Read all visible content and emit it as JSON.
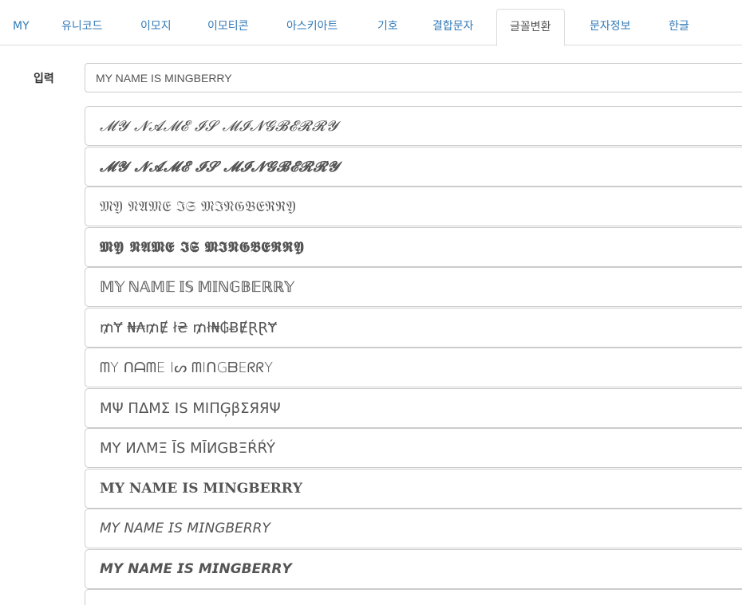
{
  "tabs": [
    {
      "label": "MY"
    },
    {
      "label": "유니코드"
    },
    {
      "label": "이모지"
    },
    {
      "label": "이모티콘"
    },
    {
      "label": "아스키아트"
    },
    {
      "label": "기호"
    },
    {
      "label": "결합문자"
    },
    {
      "label": "글꼴변환"
    },
    {
      "label": "문자정보"
    },
    {
      "label": "한글"
    }
  ],
  "active_tab": "글꼴변환",
  "input": {
    "label": "입력",
    "value": "MY NAME IS MINGBERRY"
  },
  "results": [
    {
      "text": "𝓜𝓨 𝓝𝓐𝓜𝓔 𝓘𝓢 𝓜𝓘𝓝𝓖𝓑𝓔𝓡𝓡𝓨"
    },
    {
      "text": "𝓜𝓨 𝓝𝓐𝓜𝓔 𝓘𝓢 𝓜𝓘𝓝𝓖𝓑𝓔𝓡𝓡𝓨"
    },
    {
      "text": "𝔐𝔜 𝔑𝔄𝔐𝔈 ℑ𝔖 𝔐ℑ𝔑𝔊𝔅𝔈ℜℜ𝔜"
    },
    {
      "text": "𝕸𝖄 𝕹𝕬𝕸𝕰 𝕴𝕾 𝕸𝕴𝕹𝕲𝕭𝕰𝕽𝕽𝖄"
    },
    {
      "text": "𝕄𝕐 ℕ𝔸𝕄𝔼 𝕀𝕊 𝕄𝕀ℕ𝔾𝔹𝔼ℝℝ𝕐"
    },
    {
      "text": "₥Ɏ ₦₳₥Ɇ ł₴ ₥ł₦₲ɃɆⱤⱤɎ"
    },
    {
      "text": "ᗰY ᑎᗩᗰE Iᔕ ᗰIᑎGᗷEᖇᖇY"
    },
    {
      "text": "ΜΨ ΠΔΜΣ ΙЅ ΜΙΠĢβΣЯЯΨ"
    },
    {
      "text": "MY ИΛMΞ ĪS MĪИGBΞŔŔÝ"
    },
    {
      "text": "𝐌𝐘 𝐍𝐀𝐌𝐄 𝐈𝐒 𝐌𝐈𝐍𝐆𝐁𝐄𝐑𝐑𝐘"
    },
    {
      "text": "𝘔𝘠 𝘕𝘈𝘔𝘌 𝘐𝘚 𝘔𝘐𝘕𝘎𝘉𝘌𝘙𝘙𝘠"
    },
    {
      "text": "𝙈𝙔 𝙉𝘼𝙈𝙀 𝙄𝙎 𝙈𝙄𝙉𝙂𝘽𝙀𝙍𝙍𝙔"
    }
  ],
  "colors": {
    "link": "#337ab7",
    "border": "#cccccc",
    "text": "#555555"
  }
}
